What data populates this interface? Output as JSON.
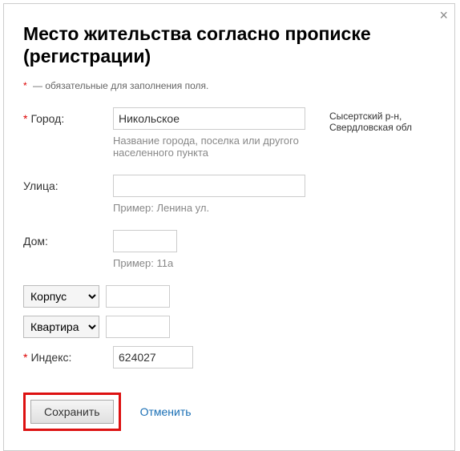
{
  "close_label": "×",
  "title": "Место жительства согласно прописке (регистрации)",
  "required_note": "— обязательные для заполнения поля.",
  "fields": {
    "city": {
      "label": "Город:",
      "value": "Никольское",
      "hint": "Название города, поселка или другого населенного пункта",
      "side": "Сысертский р-н, Свердловская обл"
    },
    "street": {
      "label": "Улица:",
      "value": "",
      "hint": "Пример: Ленина ул."
    },
    "house": {
      "label": "Дом:",
      "value": "",
      "hint": "Пример: 11а"
    },
    "corpus": {
      "select_label": "Корпус",
      "value": ""
    },
    "apartment": {
      "select_label": "Квартира",
      "value": ""
    },
    "index": {
      "label": "Индекс:",
      "value": "624027"
    }
  },
  "actions": {
    "save": "Сохранить",
    "cancel": "Отменить"
  }
}
